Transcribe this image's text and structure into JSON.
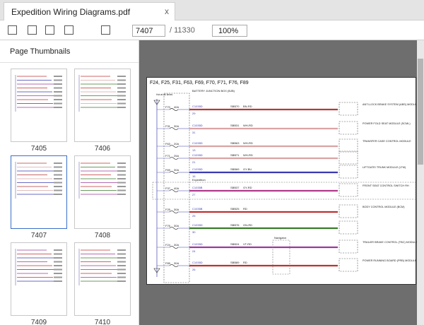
{
  "tab": {
    "title": "Expedition Wiring Diagrams.pdf",
    "close_glyph": "x"
  },
  "toolbar": {
    "buttons": [
      {
        "name": "sidebar-toggle"
      },
      {
        "name": "zoom-out"
      },
      {
        "name": "zoom-in"
      },
      {
        "name": "rotate"
      },
      {
        "name": "fit"
      }
    ],
    "page_current": "7407",
    "page_total": "/ 11330",
    "zoom": "100%"
  },
  "sidebar": {
    "title": "Page Thumbnails",
    "thumbnails": [
      {
        "label": "7405",
        "selected": false
      },
      {
        "label": "7406",
        "selected": false
      },
      {
        "label": "7407",
        "selected": true
      },
      {
        "label": "7408",
        "selected": false
      },
      {
        "label": "7409",
        "selected": false
      },
      {
        "label": "7410",
        "selected": false
      }
    ]
  },
  "diagram": {
    "header": "F24, F25, F31, F63, F69, F70, F71, F76, F89",
    "bjb": "BATTERY JUNCTION BOX (BJB)",
    "hot_label": "Hot at all times",
    "fuses": [
      {
        "fuse": "F70",
        "amps": "40A",
        "conn": "C1035D",
        "circuit": "SBB70",
        "wire": "BN-RD",
        "pin": "29",
        "module": "ANTI-LOCK BRAKE SYSTEM (ABS) MODULE",
        "color": "#b23a3a"
      },
      {
        "fuse": "F31",
        "amps": "30A",
        "conn": "C1035D",
        "circuit": "SBB31",
        "wire": "WH-RD",
        "pin": "31",
        "module": "POWER FOLD SEAT MODULE (SCML)",
        "color": "#d9a4a4"
      },
      {
        "fuse": "F63",
        "amps": "20A",
        "conn": "C1035D",
        "circuit": "SBB63",
        "wire": "WH-RD",
        "pin": "13",
        "module": "TRANSFER CASE CONTROL MODULE",
        "color": "#d9a4a4"
      },
      {
        "fuse": "F71",
        "amps": "25A",
        "conn": "C1035D",
        "circuit": "SBB71",
        "wire": "WH-RD",
        "pin": "21",
        "module": "",
        "color": "#d9a4a4"
      },
      {
        "fuse": "F69",
        "amps": "30A",
        "conn": "C1035D",
        "circuit": "SBB69",
        "wire": "GY-BU",
        "pin": "15",
        "module": "LIFTGATE/ TRUNK MODULE (LTM)",
        "color": "#3a3ab2"
      },
      {
        "fuse": "F37",
        "amps": "40A",
        "conn": "C1035B",
        "circuit": "SBB37",
        "wire": "GY-RD",
        "pin": "27",
        "module": "FRONT SEAT CONTROL SWITCH RH",
        "color": "#b03a8a"
      },
      {
        "fuse": "F25",
        "amps": "30A",
        "conn": "C1035B",
        "circuit": "SBB25",
        "wire": "RD",
        "pin": "25",
        "module": "BODY CONTROL MODULE (BCM)",
        "color": "#c03030"
      },
      {
        "fuse": "F76",
        "amps": "30A",
        "conn": "C1035D",
        "circuit": "SBB76",
        "wire": "GN-RD",
        "pin": "30",
        "module": "",
        "color": "#3a7a2a"
      },
      {
        "fuse": "F24",
        "amps": "30A",
        "conn": "C1035D",
        "circuit": "SBB24",
        "wire": "VT-RD",
        "pin": "24",
        "module": "TRAILER BRAKE CONTROL (TBC) MODULE",
        "color": "#9a3a9a"
      },
      {
        "fuse": "F89",
        "amps": "30A",
        "conn": "C1035D",
        "circuit": "SBB89",
        "wire": "RD",
        "pin": "26",
        "module": "POWER RUNNING BOARD (PRB) MODULE",
        "color": "#c03030"
      }
    ],
    "expedition_label": "Expedition",
    "navigator_label": "Navigator"
  }
}
